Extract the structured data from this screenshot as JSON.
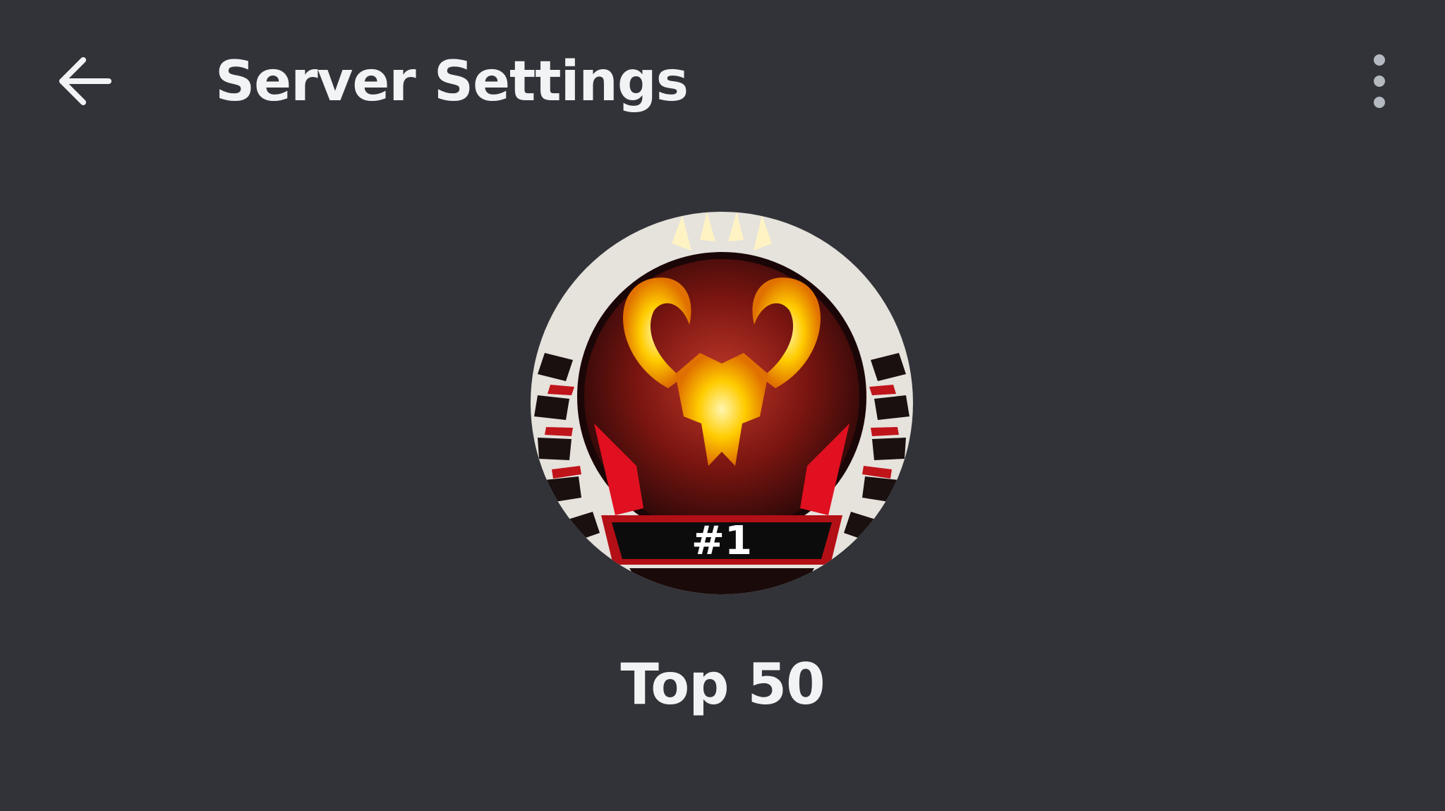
{
  "header": {
    "back_icon": "arrow-left-icon",
    "title": "Server Settings",
    "more_icon": "kebab-menu-icon"
  },
  "server": {
    "icon": "server-avatar",
    "badge_text": "#1",
    "name": "Top 50"
  },
  "colors": {
    "background": "#313338",
    "text": "#f2f3f5",
    "icon_muted": "#b5bac1"
  }
}
